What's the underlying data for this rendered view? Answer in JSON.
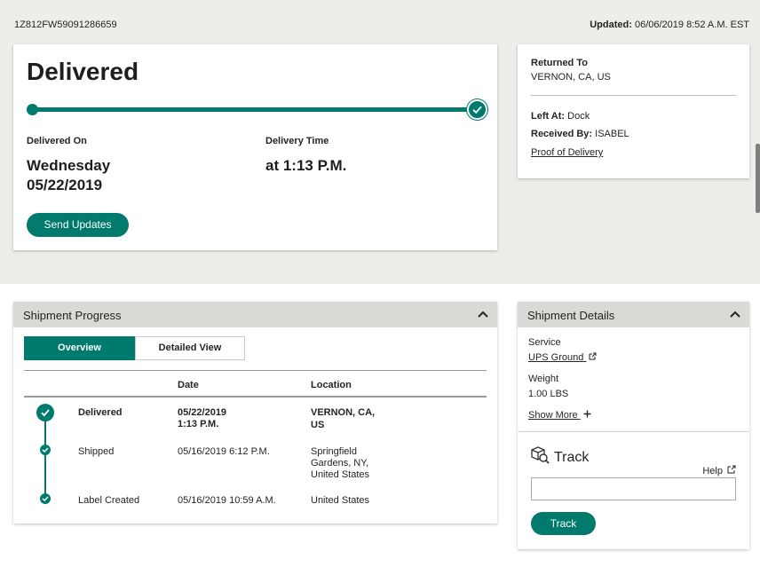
{
  "header": {
    "tracking_number": "1Z812FW59091286659",
    "updated_label": "Updated:",
    "updated_value": "06/06/2019 8:52 A.M. EST"
  },
  "status": {
    "title": "Delivered",
    "progress": 1.0,
    "delivered_on_label": "Delivered On",
    "delivered_on_day": "Wednesday",
    "delivered_on_date": "05/22/2019",
    "delivery_time_label": "Delivery Time",
    "delivery_time_value": "at 1:13 P.M.",
    "send_updates_label": "Send Updates"
  },
  "returned": {
    "returned_to_label": "Returned To",
    "returned_to_value": "VERNON, CA, US",
    "left_at_label": "Left At:",
    "left_at_value": "Dock",
    "received_by_label": "Received By:",
    "received_by_value": "ISABEL",
    "proof_link": "Proof of Delivery"
  },
  "progress_panel": {
    "title": "Shipment Progress",
    "tabs": {
      "overview": "Overview",
      "detailed": "Detailed View"
    },
    "columns": {
      "date": "Date",
      "location": "Location"
    },
    "rows": [
      {
        "status": "Delivered",
        "date_line1": "05/22/2019",
        "date_line2": "1:13 P.M.",
        "loc_line1": "VERNON, CA,",
        "loc_line2": "US",
        "loc_line3": ""
      },
      {
        "status": "Shipped",
        "date_line1": "05/16/2019  6:12 P.M.",
        "date_line2": "",
        "loc_line1": "Springfield",
        "loc_line2": "Gardens, NY,",
        "loc_line3": "United States"
      },
      {
        "status": "Label Created",
        "date_line1": "05/16/2019  10:59 A.M.",
        "date_line2": "",
        "loc_line1": "United States",
        "loc_line2": "",
        "loc_line3": ""
      }
    ]
  },
  "details_panel": {
    "title": "Shipment Details",
    "service_label": "Service",
    "service_value": "UPS Ground",
    "weight_label": "Weight",
    "weight_value": "1.00 LBS",
    "show_more": "Show More"
  },
  "track": {
    "title": "Track",
    "help": "Help",
    "input_value": "",
    "button": "Track"
  },
  "colors": {
    "accent": "#007a6c",
    "band": "#ededea",
    "panel_head": "#d9d9d6"
  }
}
